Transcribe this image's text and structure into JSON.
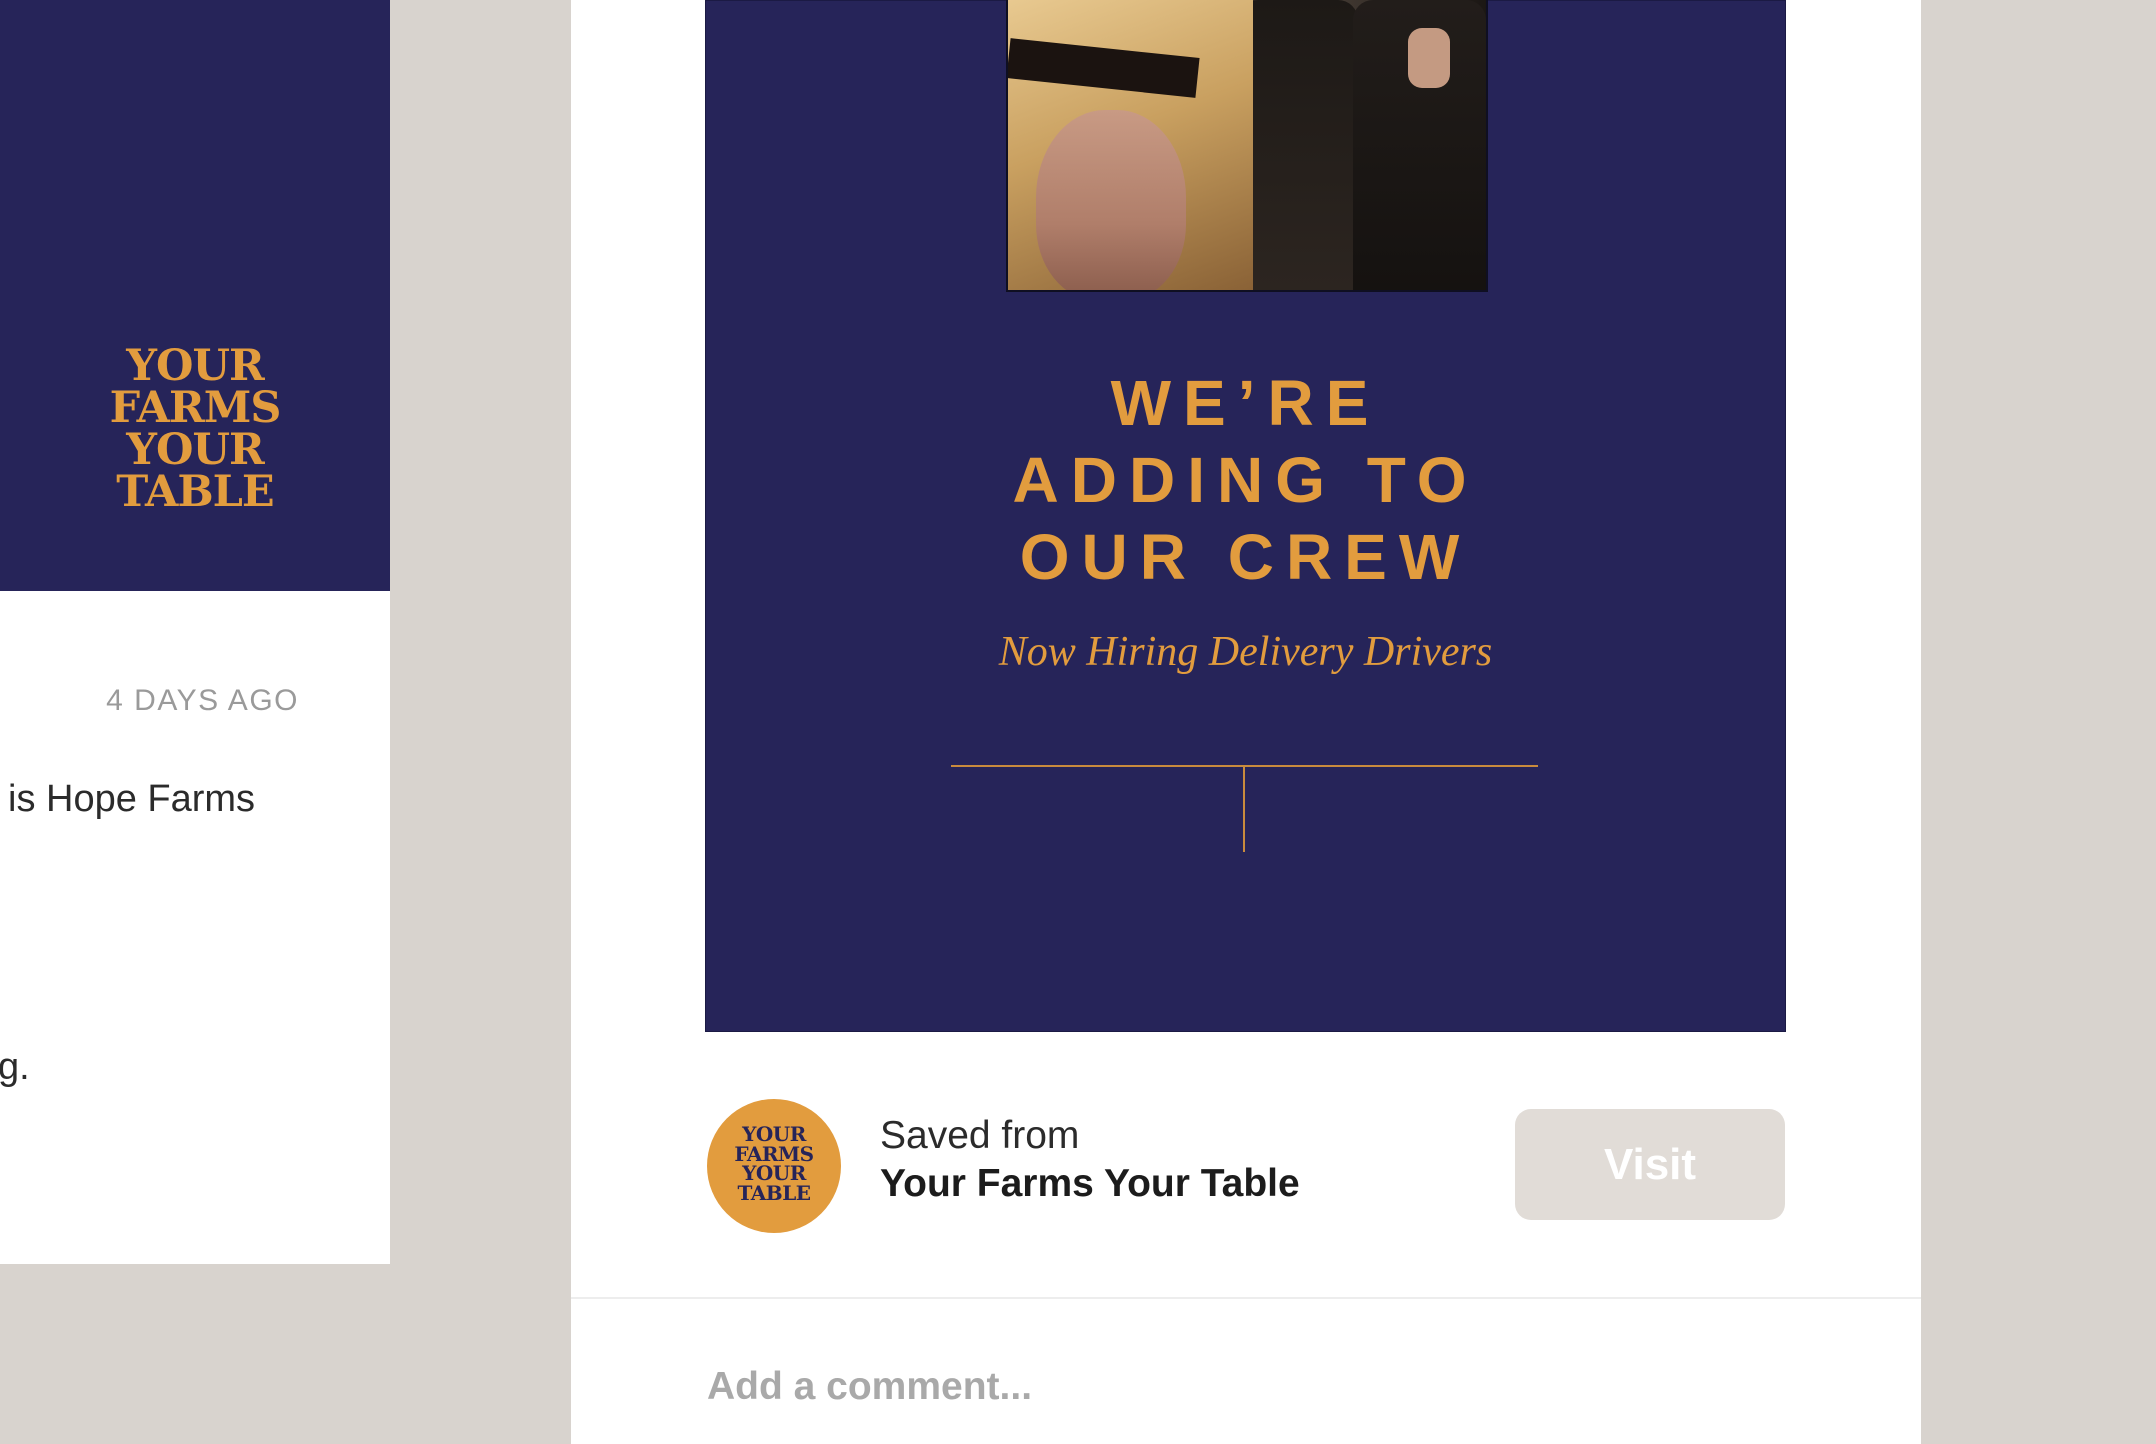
{
  "brand": {
    "logo_lines": [
      "YOUR",
      "FARMS",
      "YOUR",
      "TABLE"
    ],
    "color_gold": "#e29c3e",
    "color_navy": "#262459"
  },
  "left_card": {
    "timestamp": "4 DAYS AGO",
    "body_line_1": "is Hope Farms",
    "body_line_2": "g."
  },
  "pin": {
    "headline_lines": [
      "WE’RE",
      "ADDING TO",
      "OUR CREW"
    ],
    "subheading": "Now Hiring Delivery Drivers"
  },
  "source": {
    "saved_label": "Saved from",
    "site_name": "Your Farms Your Table",
    "visit_label": "Visit"
  },
  "comment": {
    "placeholder": "Add a comment..."
  }
}
